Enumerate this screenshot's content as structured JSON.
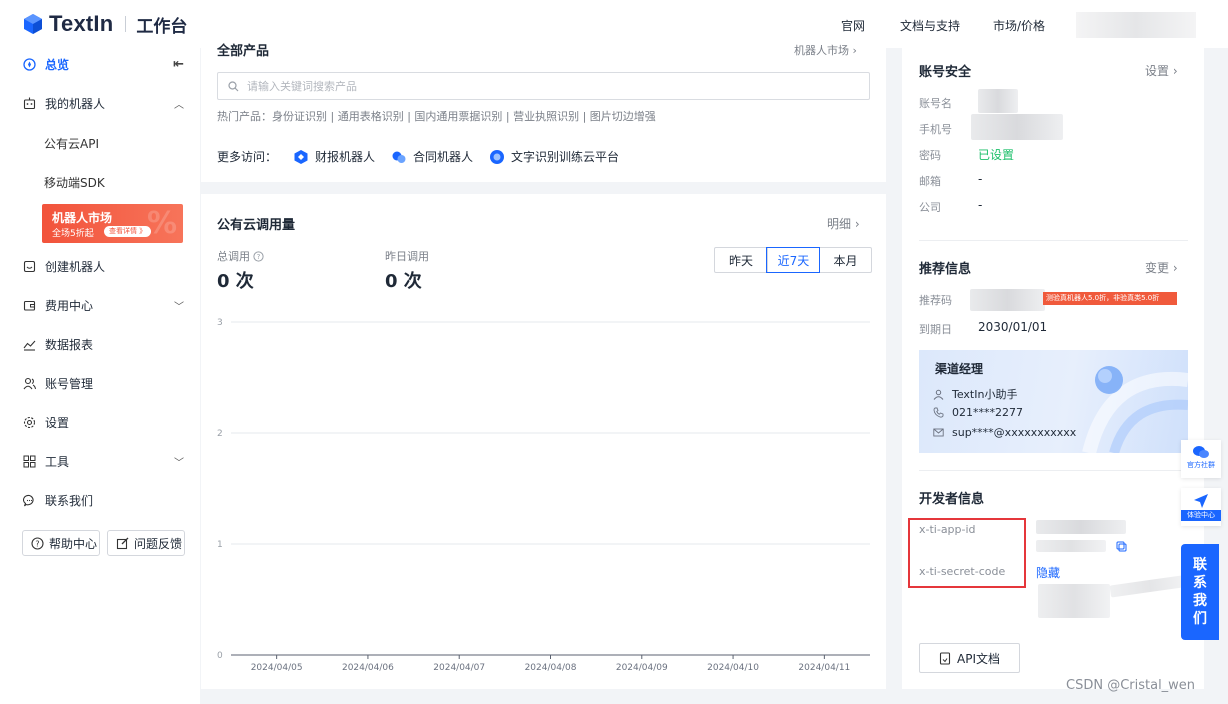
{
  "brand": {
    "logo_text": "TextIn",
    "subtitle": "工作台"
  },
  "topnav": {
    "items": [
      "官网",
      "文档与支持",
      "市场/价格"
    ]
  },
  "sidebar": {
    "overview": "总览",
    "my_robots": "我的机器人",
    "sub_items": [
      "公有云API",
      "移动端SDK"
    ],
    "promo": {
      "title": "机器人市场",
      "subtitle": "全场5折起",
      "button": "查看详情 》",
      "deco": "%"
    },
    "create_robot": "创建机器人",
    "billing": "费用中心",
    "reports": "数据报表",
    "account": "账号管理",
    "settings": "设置",
    "tools": "工具",
    "contact": "联系我们",
    "help_center": "帮助中心",
    "feedback": "问题反馈"
  },
  "products": {
    "title": "全部产品",
    "market_link": "机器人市场 ›",
    "search_placeholder": "请输入关键词搜索产品",
    "hot_label": "热门产品：",
    "hot_items": "身份证识别 | 通用表格识别 | 国内通用票据识别 | 营业执照识别 | 图片切边增强",
    "more_label": "更多访问：",
    "more_items": [
      "财报机器人",
      "合同机器人",
      "文字识别训练云平台"
    ]
  },
  "usage": {
    "title": "公有云调用量",
    "detail_link": "明细 ›",
    "total_label": "总调用",
    "total_value": "0 次",
    "yesterday_label": "昨日调用",
    "yesterday_value": "0 次",
    "ranges": [
      "昨天",
      "近7天",
      "本月"
    ],
    "selected_range": "近7天"
  },
  "chart_data": {
    "type": "line",
    "x": [
      "2024/04/05",
      "2024/04/06",
      "2024/04/07",
      "2024/04/08",
      "2024/04/09",
      "2024/04/10",
      "2024/04/11"
    ],
    "series": [
      {
        "values": [
          0,
          0,
          0,
          0,
          0,
          0,
          0
        ]
      }
    ],
    "ylim": [
      0,
      3
    ],
    "yticks": [
      0,
      1,
      2,
      3
    ],
    "grid": true,
    "color": "#1a66ff"
  },
  "security": {
    "title": "账号安全",
    "settings_link": "设置 ›",
    "rows": [
      {
        "label": "账号名",
        "value": ""
      },
      {
        "label": "手机号",
        "value": ""
      },
      {
        "label": "密码",
        "value": "已设置"
      },
      {
        "label": "邮箱",
        "value": "-"
      },
      {
        "label": "公司",
        "value": "-"
      }
    ]
  },
  "recommend": {
    "title": "推荐信息",
    "change_link": "变更 ›",
    "code_label": "推荐码",
    "promo_tag": "测验真机器人5.0折，非验真类5.0折",
    "expiry_label": "到期日",
    "expiry_value": "2030/01/01"
  },
  "channel": {
    "title": "渠道经理",
    "name": "TextIn小助手",
    "phone": "021****2277",
    "email": "sup****@xxxxxxxxxxx"
  },
  "developer": {
    "title": "开发者信息",
    "app_id_label": "x-ti-app-id",
    "secret_label": "x-ti-secret-code",
    "hide_link": "隐藏",
    "api_doc": "API文档"
  },
  "floating": {
    "community": "官方社群",
    "experience": "体验中心",
    "contact": [
      "联",
      "系",
      "我",
      "们"
    ]
  },
  "watermark": "CSDN @Cristal_wen",
  "colors": {
    "accent": "#1a66ff",
    "promo": "#f2533b",
    "highlight": "#e5363b",
    "success": "#1cbf6a"
  }
}
